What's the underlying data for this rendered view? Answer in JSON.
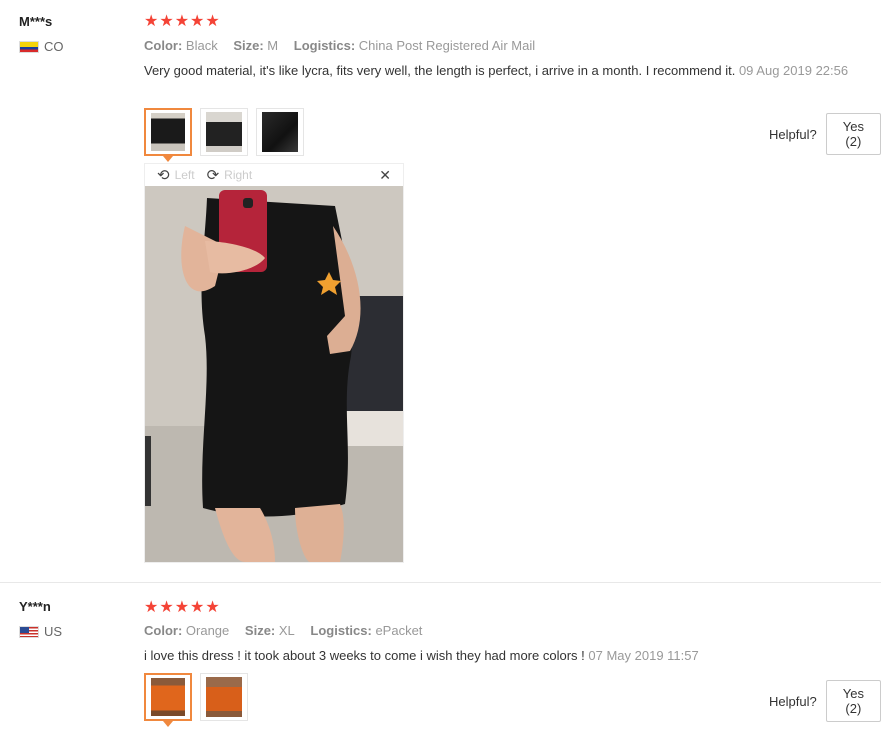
{
  "reviews": [
    {
      "user": "M***s",
      "country": "CO",
      "stars": "★★★★★",
      "color_label": "Color:",
      "color_value": "Black",
      "size_label": "Size:",
      "size_value": "M",
      "logistics_label": "Logistics:",
      "logistics_value": "China Post Registered Air Mail",
      "text": "Very good material, it's like lycra, fits very well, the length is perfect, i arrive in a month. I recommend it.",
      "date": "09 Aug 2019 22:56",
      "helpful_label": "Helpful?",
      "yes_label": "Yes (2)",
      "viewer": {
        "left_label": "Left",
        "right_label": "Right",
        "close": "✕"
      }
    },
    {
      "user": "Y***n",
      "country": "US",
      "stars": "★★★★★",
      "color_label": "Color:",
      "color_value": "Orange",
      "size_label": "Size:",
      "size_value": "XL",
      "logistics_label": "Logistics:",
      "logistics_value": "ePacket",
      "text": "i love this dress ! it took about 3 weeks to come i wish they had more colors !",
      "date": "07 May 2019 11:57",
      "helpful_label": "Helpful?",
      "yes_label": "Yes (2)"
    }
  ],
  "colors": {
    "star": "#f44336",
    "accent": "#f0883e"
  }
}
